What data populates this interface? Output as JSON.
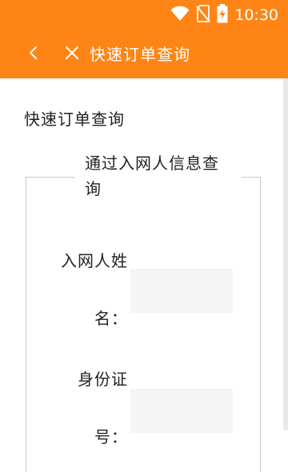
{
  "status_bar": {
    "time": "10:30",
    "icons": [
      "wifi-icon",
      "no-sim-icon",
      "battery-charging-icon"
    ]
  },
  "app_bar": {
    "title": "快速订单查询",
    "back_icon": "chevron-left-icon",
    "close_icon": "close-icon",
    "background_color": "#fe8515"
  },
  "page": {
    "section_title": "快速订单查询",
    "fieldset_legend": "通过入网人信息查询",
    "fields": {
      "name_label_line1": "入网人姓",
      "name_label_line2": "名：",
      "name_value": "",
      "id_label_line1": "身份证",
      "id_label_line2": "号：",
      "id_value": ""
    }
  }
}
